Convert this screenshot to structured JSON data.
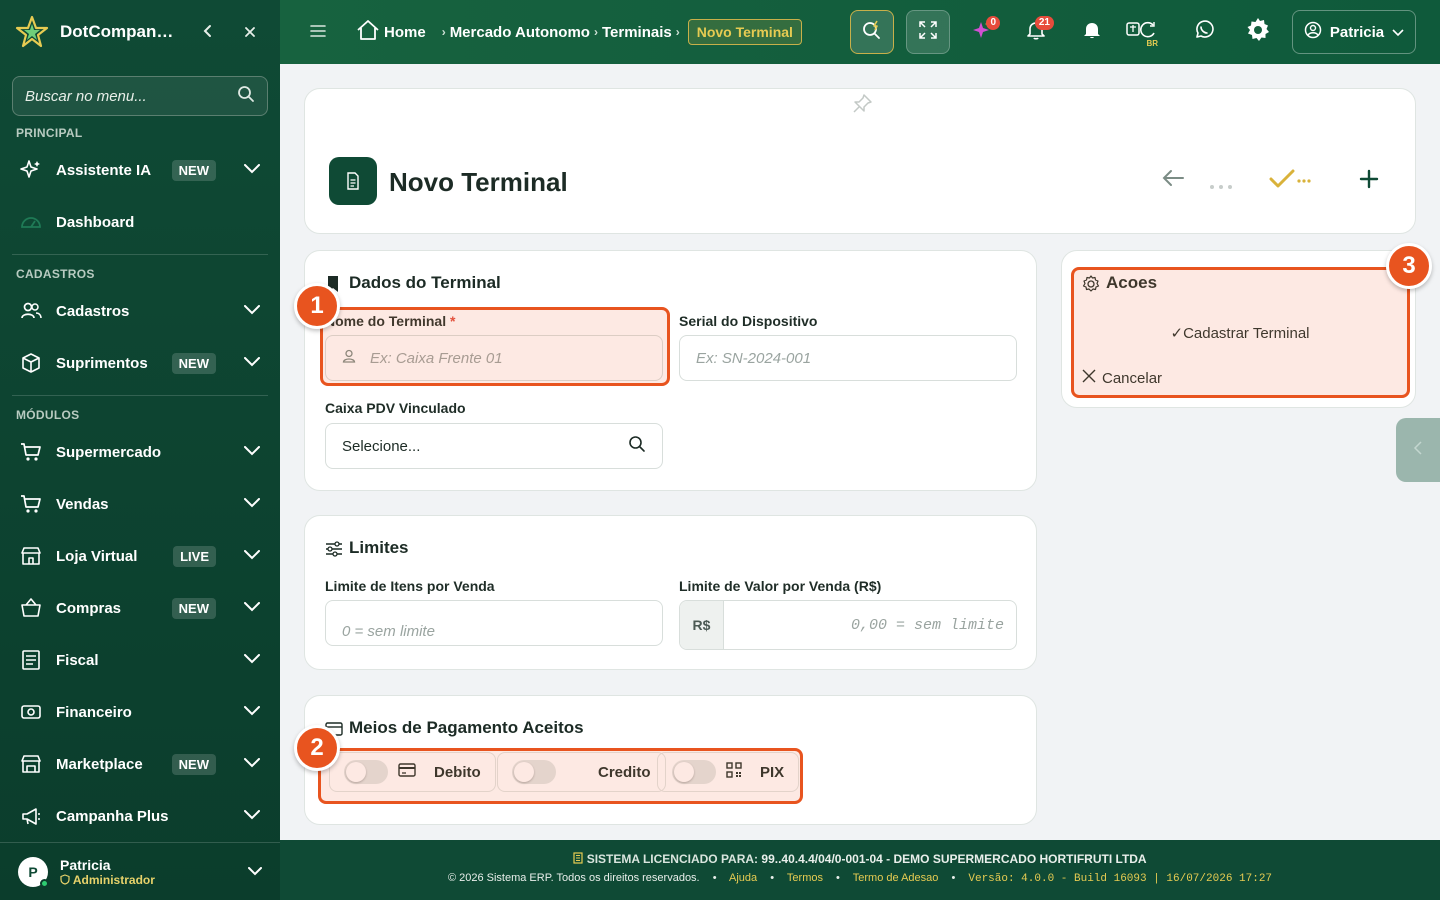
{
  "sidebar": {
    "brand": "DotCompan…",
    "search_placeholder": "Buscar no menu...",
    "sections": {
      "principal": "PRINCIPAL",
      "cadastros": "CADASTROS",
      "modulos": "MÓDULOS"
    },
    "items": [
      {
        "label": "Assistente IA",
        "badge": "NEW"
      },
      {
        "label": "Dashboard",
        "badge": ""
      },
      {
        "label": "Cadastros",
        "badge": ""
      },
      {
        "label": "Suprimentos",
        "badge": "NEW"
      },
      {
        "label": "Supermercado",
        "badge": ""
      },
      {
        "label": "Vendas",
        "badge": ""
      },
      {
        "label": "Loja Virtual",
        "badge": "LIVE"
      },
      {
        "label": "Compras",
        "badge": "NEW"
      },
      {
        "label": "Fiscal",
        "badge": ""
      },
      {
        "label": "Financeiro",
        "badge": ""
      },
      {
        "label": "Marketplace",
        "badge": "NEW"
      },
      {
        "label": "Campanha Plus",
        "badge": ""
      }
    ],
    "user": {
      "initial": "P",
      "name": "Patricia",
      "role": "Administrador"
    }
  },
  "topbar": {
    "breadcrumb": [
      "Home",
      "Mercado Autonomo",
      "Terminais"
    ],
    "breadcrumb_active": "Novo Terminal",
    "ai_count": "0",
    "notif_count": "21",
    "lang": "BR",
    "user": "Patricia"
  },
  "page": {
    "title": "Novo Terminal"
  },
  "dados": {
    "title": "Dados do Terminal",
    "nome_label": "Nome do Terminal",
    "nome_required": "*",
    "nome_placeholder": "Ex: Caixa Frente 01",
    "serial_label": "Serial do Dispositivo",
    "serial_placeholder": "Ex: SN-2024-001",
    "caixa_label": "Caixa PDV Vinculado",
    "caixa_placeholder": "Selecione..."
  },
  "limites": {
    "title": "Limites",
    "itens_label": "Limite de Itens por Venda",
    "itens_placeholder": "0 = sem limite",
    "valor_label": "Limite de Valor por Venda (R$)",
    "valor_prefix": "R$",
    "valor_placeholder": "0,00 = sem limite"
  },
  "pagamento": {
    "title": "Meios de Pagamento Aceitos",
    "options": [
      {
        "label": "Debito",
        "icon": "card-icon",
        "enabled": false
      },
      {
        "label": "Credito",
        "icon": "",
        "enabled": false
      },
      {
        "label": "PIX",
        "icon": "qr-icon",
        "enabled": false
      }
    ]
  },
  "acoes": {
    "title": "Acoes",
    "submit": "Cadastrar Terminal",
    "cancel": "Cancelar"
  },
  "annotations": [
    "1",
    "2",
    "3"
  ],
  "footer": {
    "license_label": "SISTEMA LICENCIADO PARA:",
    "license_value": "99..40.4.4/04/0-001-04 - DEMO SUPERMERCADO HORTIFRUTI LTDA",
    "copyright": "© 2026 Sistema ERP. Todos os direitos reservados.",
    "links": [
      "Ajuda",
      "Termos",
      "Termo de Adesao"
    ],
    "version": "Versão: 4.0.0 - Build 16093 | 16/07/2026 17:27"
  },
  "colors": {
    "primary": "#0f4a35",
    "accent": "#e6cb52",
    "annotation": "#e8541f"
  }
}
